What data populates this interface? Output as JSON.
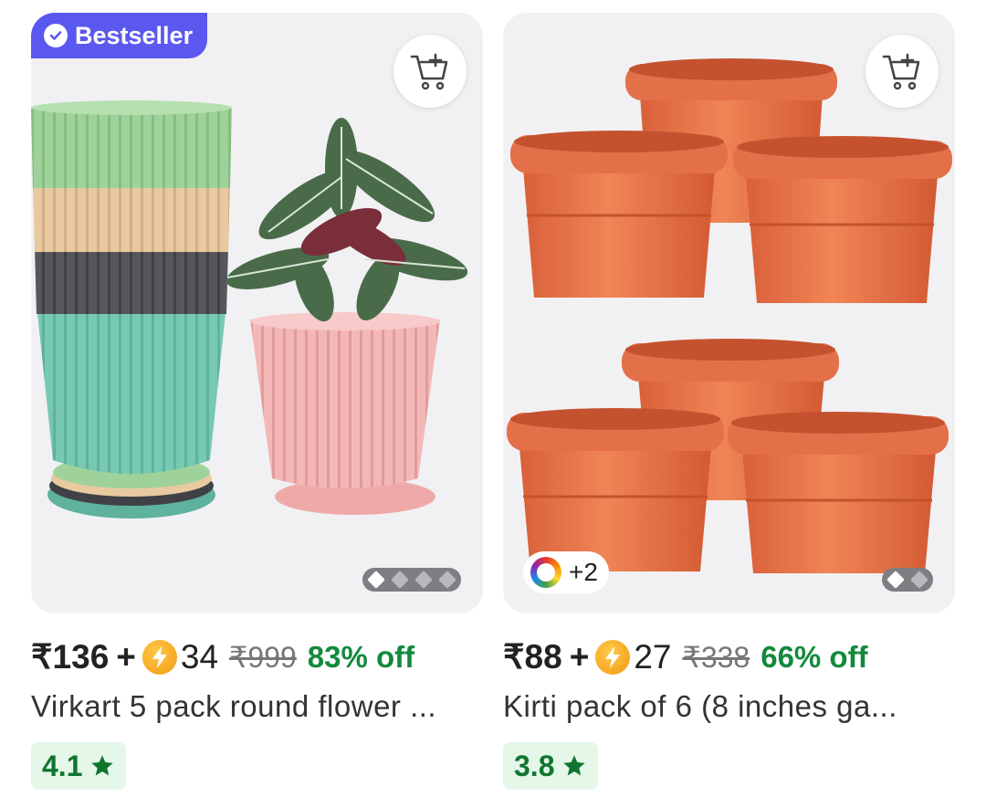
{
  "colors": {
    "brand": "#5b58f0",
    "discount": "#128a3c",
    "rating_bg": "#e5f7e9",
    "rating_text": "#10762f"
  },
  "products": [
    {
      "badge": "Bestseller",
      "badge_icon": "verified-check-icon",
      "cart_icon": "add-to-cart-icon",
      "price": "₹136",
      "plus": "+",
      "coins": "34",
      "mrp": "₹999",
      "discount": "83% off",
      "title": "Virkart 5 pack round flower ...",
      "rating": "4.1",
      "rating_icon": "star-icon",
      "image_slides": 4,
      "active_slide": 1
    },
    {
      "swatch_label": "+2",
      "cart_icon": "add-to-cart-icon",
      "price": "₹88",
      "plus": "+",
      "coins": "27",
      "mrp": "₹338",
      "discount": "66% off",
      "title": "Kirti pack of 6 (8 inches ga...",
      "rating": "3.8",
      "rating_icon": "star-icon",
      "image_slides": 2,
      "active_slide": 1
    }
  ]
}
